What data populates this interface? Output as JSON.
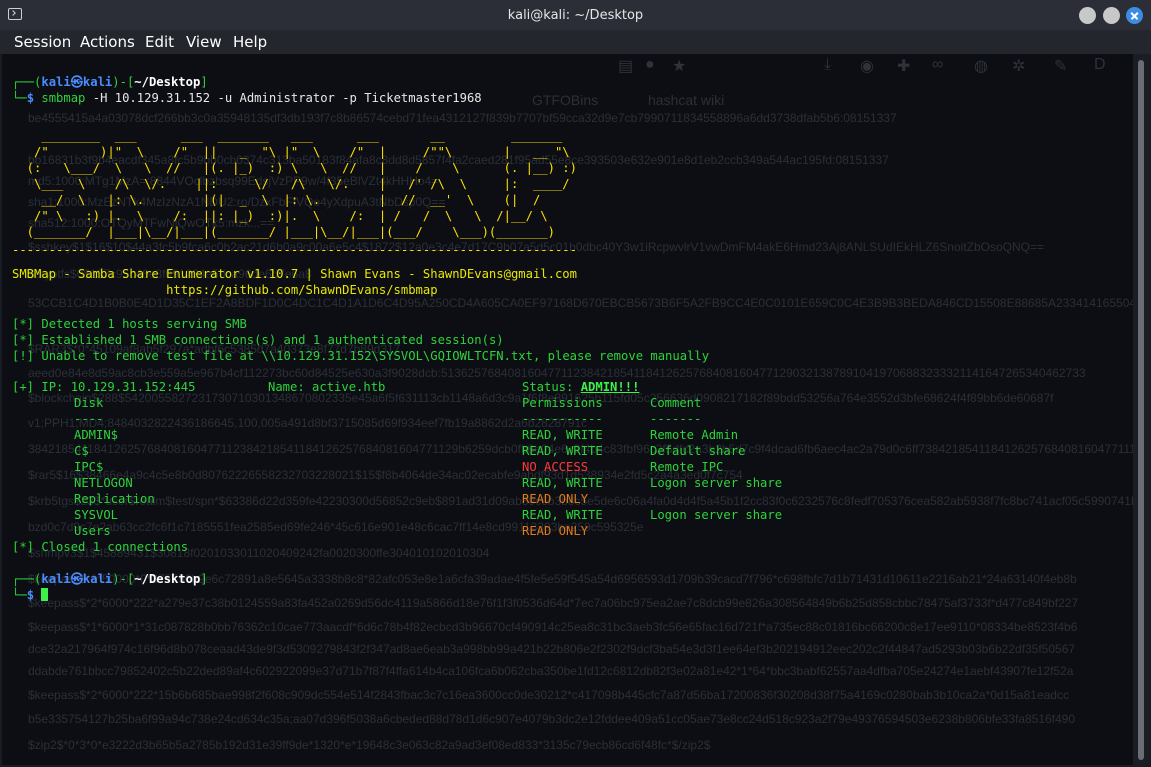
{
  "window": {
    "title": "kali@kali: ~/Desktop"
  },
  "menu": [
    "Session",
    "Actions",
    "Edit",
    "View",
    "Help"
  ],
  "prompt": {
    "user": "kali",
    "at": "㉿",
    "host": "kali",
    "path": "~/Desktop"
  },
  "command": {
    "name": "smbmap",
    "args": " -H 10.129.31.152 -u Administrator -p Ticketmaster1968"
  },
  "banner": [
    "    ________  ___      ___  _______   ___      ___       __         _______",
    "   /\"       )|\"  \\    /\"  ||   _  \"\\ |\"  \\    /\"  |     /\"\"\\       |   __ \"\\",
    "  (:   \\___/  \\   \\  //   |(. |_)  :) \\   \\  //   |    /    \\      (. |__) :)",
    "   \\___  \\    /\\  \\/.    ||:     \\/   /\\   \\/.    |   /' /\\  \\     |:  ____/",
    "    __/  \\   |: \\.        |(|  _  \\  |: \\.        |  //  __'  \\    (|  /",
    "   /\" \\   :) |.  \\    /:  ||: |_)  :)|.  \\    /:  | /   /  \\   \\  /|__/ \\",
    "  (_______/  |___|\\__/|___|(_______/ |___|\\__/|___|(___/    \\___)(_______)",
    "-----------------------------------------------------------------------------"
  ],
  "info": {
    "title_line": "SMBMap - Samba Share Enumerator v1.10.7 | Shawn Evans - ShawnDEvans@gmail.com",
    "url_line": "                     https://github.com/ShawnDEvans/smbmap"
  },
  "status": [
    {
      "tag": "[*]",
      "text": " Detected 1 hosts serving SMB"
    },
    {
      "tag": "[*]",
      "text": " Established 1 SMB connections(s) and 1 authenticated session(s)"
    },
    {
      "tag": "[!]",
      "text": " Unable to remove test file at \\\\10.129.31.152\\SYSVOL\\GQIOWLTCFN.txt, please remove manually"
    }
  ],
  "host": {
    "tag": "[+]",
    "ip_text": " IP: 10.129.31.152:445",
    "name_text": "Name: active.htb",
    "status_label": "Status: ",
    "status_value": "ADMIN!!!"
  },
  "shares_header": {
    "disk": "Disk",
    "perm": "Permissions",
    "comment": "Comment"
  },
  "shares_sep": {
    "disk": "----",
    "perm": "-----------",
    "comment": "-------"
  },
  "shares": [
    {
      "disk": "ADMIN$",
      "perm": "READ, WRITE",
      "comment": "Remote Admin",
      "color": "#2ed33a"
    },
    {
      "disk": "C$",
      "perm": "READ, WRITE",
      "comment": "Default share",
      "color": "#2ed33a"
    },
    {
      "disk": "IPC$",
      "perm": "NO ACCESS",
      "comment": "Remote IPC",
      "color": "#ff3a3a"
    },
    {
      "disk": "NETLOGON",
      "perm": "READ, WRITE",
      "comment": "Logon server share",
      "color": "#2ed33a"
    },
    {
      "disk": "Replication",
      "perm": "READ ONLY",
      "comment": "",
      "color": "#e07b1a"
    },
    {
      "disk": "SYSVOL",
      "perm": "READ, WRITE",
      "comment": "Logon server share",
      "color": "#2ed33a"
    },
    {
      "disk": "Users",
      "perm": "READ ONLY",
      "comment": "",
      "color": "#e07b1a"
    }
  ],
  "closed": {
    "tag": "[*]",
    "text": " Closed 1 connections"
  },
  "background_ghost": [
    "GTFOBins",
    "hashcat wiki",
    "be4555415a4a03078dcf266bb3c0a35948135df3db193f7c8b86574cebd71fea4312127f839b7707bf59cca32d9e7cb7990711834558896a6dd3738dfab5b6:08151337",
    "bb16831b3f9b4eacdf345a8fc5b9bb0cb0374c313ba50183f84afa8c8dd8d5857f4fa2caed281f95ad55e8ce393503e632e901e8d1eb2ccb349a544ac195fd:08151337",
    "md5:1000:MTg1MzA=:8844VOclbzbsq99EdsjVzPP9w/4f35eBlVZt4kHHHo4=",
    "sha1:1000:MzEzNTk4MzIzNzA1NDU2:ro/DzxFbFfVQo4yXdpuA3tNbDsp0Q==",
    "sha512:1000:OTQyMTFwNjQwOTk5:mzk...==",
    "$sshkey$1$16$10$44a3fc5b9fca6c0b2ac21d6b0a9c00a6e5c4$1872$12a0e3c4e7d17C9b07a5d5c01b0dbc40Y3w1iRcpwvlrV1vwDmFM4akE6Hmd23Aj8ANLSUdIEkHLZ6SnoitZbOsoQNQ==",
    "$cryptfs$0$1$7c95c46e8f091234a5dca96de6d7e6a8",
    "53CCB1C4D1B0B0E4D1D35C1EF2A8BDF1D0C4DC1C4D1A1D6C4D95A250CD4A605CA0EF97168D670EBCB5673B6F5A2FB9CC4E0C0101E659C0C4E3B9B3BEDA846CD15508E88685A2334141655046766110",
    "$RAR3$*0*45109af8ab5f297a*adbf6c5385d7a40373e8f77d7b89d317",
    "aeed0e84e8d59ac8cb3e559a5e967b4cf112273bc60d84525e630a3f9028dcb:5136257684081604771123842185411841262576840816047712903213878910419706883233321141647265340462733",
    "$blockchain$288$5420055827231730710301348670802335e45a6f5f631113cb1148a6d3c9a1f6f8e891625b115fd05c256636d0908217182f89bdd53256a764e3552d3bfe68624f4f89bb6de60687f",
    "v1;PPH1;MD4;8484032822436186645,100,005a491d8bf3715085d69f934eef7fb19a8862d2a6b2828791c",
    "38421854118412625768408160477112384218541184126257684081604771129b6259dcb0fb8e04e6c2f4b4c83fbf96c3f5dfc2a3b2b5d7c9f4dcad6fb6aec4ac2a79d0c6ff7384218541184126257684081604771112",
    "$rar5$16$38466e4a9c4c5e8b0d80762226558232703228021$15$f8b4064de34ac02ecabfe9abdf93d1d538934e2fd5c2a4a3ed0f7c754",
    "$krb5tgs$23$*user$realm$test/spn*$63386d22d359fe42230300d56852c9eb$891ad31d09ab89c6b3b8c5e5de6c06a4fa0d4d4f5a45b1f2cc83f0c6232576c8fedf705376cea582ab5938f7fc8bc741acf05c5990741b",
    "bzd0c7d9c7e2ab63cc2fc6f1c7185551fea2585ed69fe246*45c616e901e48c6cac7ff14e8cd99113393be259c595325e",
    "$snmpv3$1$45889431$30818f0201033011020409242fa0020300ffe304010102010304",
    "$keepass$*1*50000*0*375756b9e6c72891a8e5645a3338b8c8*82afc053e8e1a6cfa39adae4f5fe5e59f545a54d6956593d1709b39cacd7f796*c698fbfc7d1b71431d10611e2216ab21*24a63140f4eb8b",
    "$keepass$*2*6000*222*a279e37c38b0124559a83fa452a0269d56dc4119a5866d18e76f1f3f0536d64d*7ec7a06bc975ea2ae7c8dcb99e826a308564849b6b25d858cbbc78475af3733f*d477c849bf227",
    "$keepass$*1*6000*1*31c087828b0bb76362c10cae773aacdf*6d6c78b4f82ecbcd3b96670cf490914c25ea8c31bc3aeb3fc56e65fac16d721f*a735ec88c01816bc66200c8e17ee9110*08334be8523f4b6",
    "dce32a217964f974c16f96d8b078ceaad43de9f3d5309279843f2f347ad8ae6eab3a998bb99a421b22b806e2f2302f9dcf3ba54e3d3f1ee64ef3b202194912eec202c2f44847ad5293b03b6b22df35f50567",
    "ddabde761bbcc79852402c5b22ded89af4c602922099e37d71b7f87f4ffa614b4ca106fca6b062cba350be1fd12c6812db82f3e02a81e42*1*64*bbc3babf62557aa4dfba705e24274e1aebf43907fe12f52a",
    "$keepass$*2*6000*222*15b6b685bae998f2f608c909dc554e514f2843fbac3c7c16ea3600cc0de30212*c417098b445cfc7a87d56ba17200836f30208d38f75a4169c0280bab3b10ca2a*0d15a81eadcc",
    "b5e335754127b25ba6f99a94c738e24cd634c35a;aa07d396f5038a6cbeded88d78d1d6c907e4079b3dc2e12fddee409a51cc05ae73e8cc24d518c923a2f79e49376594503e6238b806bfe33fa8516f490",
    "$zip2$*0*3*0*e3222d3b65b5a2785b192d31e39ff9de*1320*e*19648c3e063c82a9ad3ef08ed833*3135c79ecb86cd6f48fc*$/zip2$"
  ]
}
